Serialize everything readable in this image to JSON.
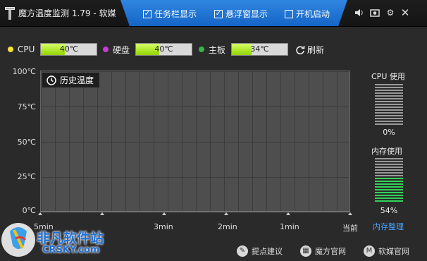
{
  "window": {
    "title": "魔方温度监测 1.79 - 软媒",
    "options": [
      {
        "label": "任务栏显示",
        "checked": true
      },
      {
        "label": "悬浮窗显示",
        "checked": true
      },
      {
        "label": "开机启动",
        "checked": false
      }
    ],
    "icons": [
      "speaker-icon",
      "camera-icon",
      "gear-icon",
      "close-icon"
    ]
  },
  "sensors": [
    {
      "label": "CPU",
      "value": "40℃",
      "dot_color": "#f7e03a",
      "fill_fraction": 0.42
    },
    {
      "label": "硬盘",
      "value": "40℃",
      "dot_color": "#c83bd6",
      "fill_fraction": 0.42
    },
    {
      "label": "主板",
      "value": "34℃",
      "dot_color": "#38b54a",
      "fill_fraction": 0.36
    }
  ],
  "refresh_label": "刷新",
  "chart": {
    "badge": "历史温度",
    "y_labels": [
      "100℃",
      "75℃",
      "50℃",
      "25℃",
      "0℃"
    ],
    "x_labels": [
      "5min",
      "3min",
      "2min",
      "1min",
      "当前"
    ]
  },
  "meters": {
    "cpu_title": "CPU 使用",
    "cpu_value": "0%",
    "cpu_fraction": 0.0,
    "mem_title": "内存使用",
    "mem_value": "54%",
    "mem_fraction": 0.54,
    "mem_clean": "内存整理"
  },
  "footer": [
    {
      "label": "提点建议",
      "icon": "feedback-icon"
    },
    {
      "label": "魔方官网",
      "icon": "grid-icon"
    },
    {
      "label": "软媒官网",
      "icon": "ruanmei-logo-icon"
    }
  ],
  "watermark": {
    "line1": "非凡软件站",
    "line2": "CRSKY.com"
  },
  "colors": {
    "accent": "#1e73d6",
    "meter_on": "#33d35a",
    "temp_fill": "#a6e31a"
  }
}
